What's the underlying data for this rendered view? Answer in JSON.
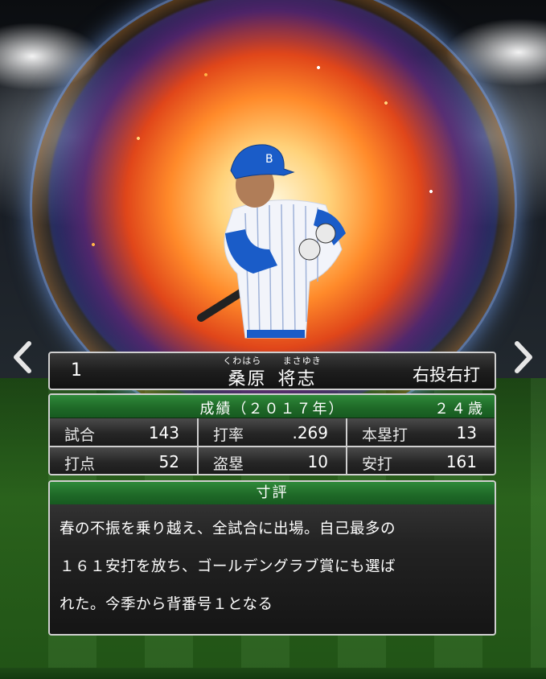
{
  "player": {
    "uniform_number": "1",
    "name_ruby_family": "くわはら",
    "name_ruby_given": "まさゆき",
    "family_name": "桑原",
    "given_name": "将志",
    "throw_bat": "右投右打"
  },
  "stats": {
    "title": "成績（２０１７年）",
    "age": "２４歳",
    "items": [
      {
        "label": "試合",
        "value": "143"
      },
      {
        "label": "打率",
        "value": ".269"
      },
      {
        "label": "本塁打",
        "value": "13"
      },
      {
        "label": "打点",
        "value": "52"
      },
      {
        "label": "盗塁",
        "value": "10"
      },
      {
        "label": "安打",
        "value": "161"
      }
    ]
  },
  "comment": {
    "title": "寸評",
    "lines": [
      "春の不振を乗り越え、全試合に出場。自己最多の",
      "１６１安打を放ち、ゴールデングラブ賞にも選ば",
      "れた。今季から背番号１となる"
    ]
  },
  "icons": {
    "left_arrow": "chevron-left-icon",
    "right_arrow": "chevron-right-icon"
  },
  "colors": {
    "header_green": "#1f6a28",
    "panel_border": "#cfcfcf",
    "jersey_blue": "#1a5cc8"
  }
}
